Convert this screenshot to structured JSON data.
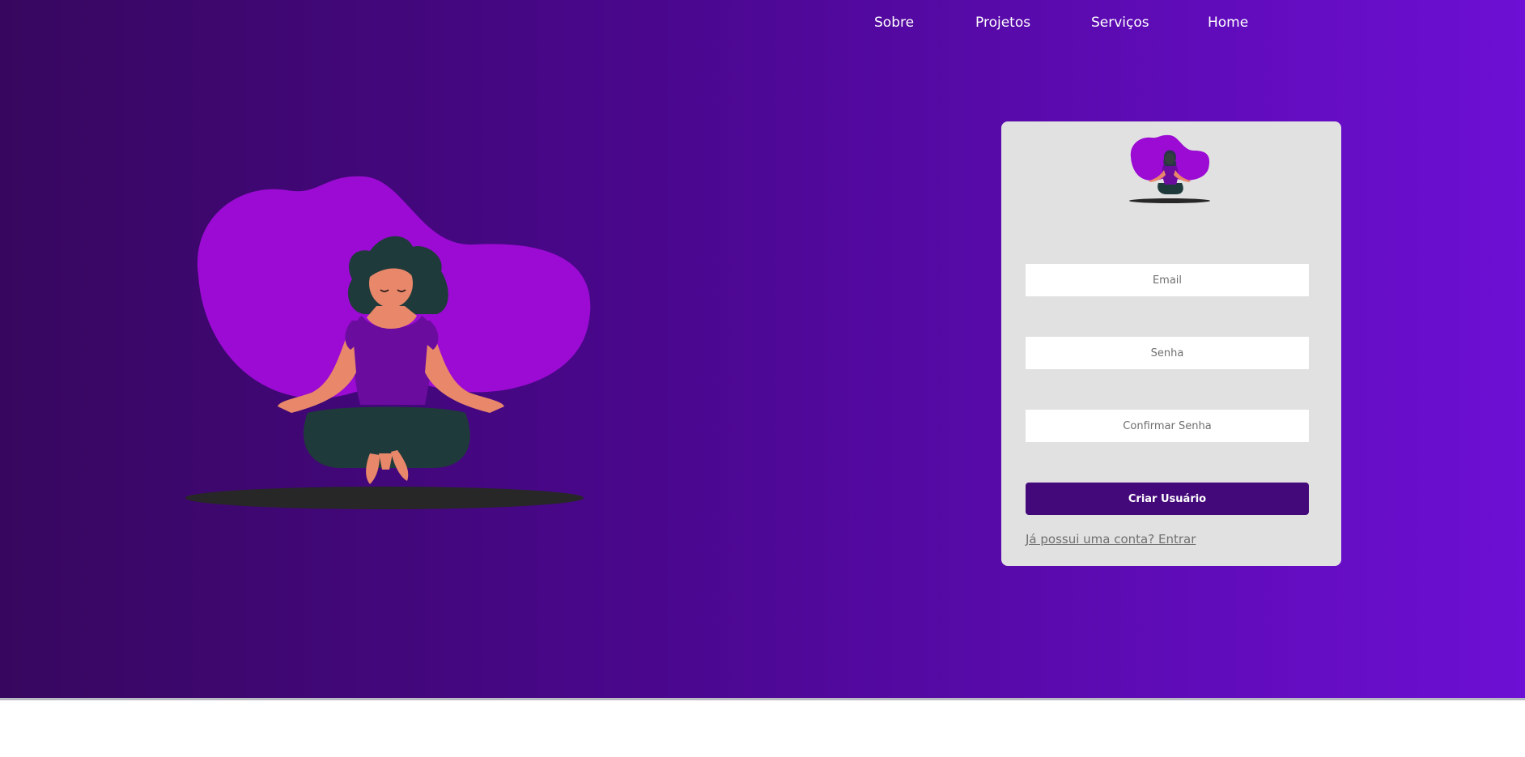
{
  "nav": {
    "items": [
      {
        "label": "Sobre"
      },
      {
        "label": "Projetos"
      },
      {
        "label": "Serviços"
      },
      {
        "label": "Home"
      }
    ]
  },
  "form": {
    "email_placeholder": "Email",
    "password_placeholder": "Senha",
    "confirm_password_placeholder": "Confirmar Senha",
    "submit_label": "Criar Usuário",
    "login_link": "Já possui uma conta? Entrar"
  },
  "colors": {
    "gradient_start": "#37075f",
    "gradient_end": "#6d0fd4",
    "card_background": "#e1e1e1",
    "button": "#43087a",
    "blob": "#9b0bd3"
  },
  "icons": {
    "illustration": "meditating-woman-illustration",
    "logo": "meditating-woman-logo"
  }
}
